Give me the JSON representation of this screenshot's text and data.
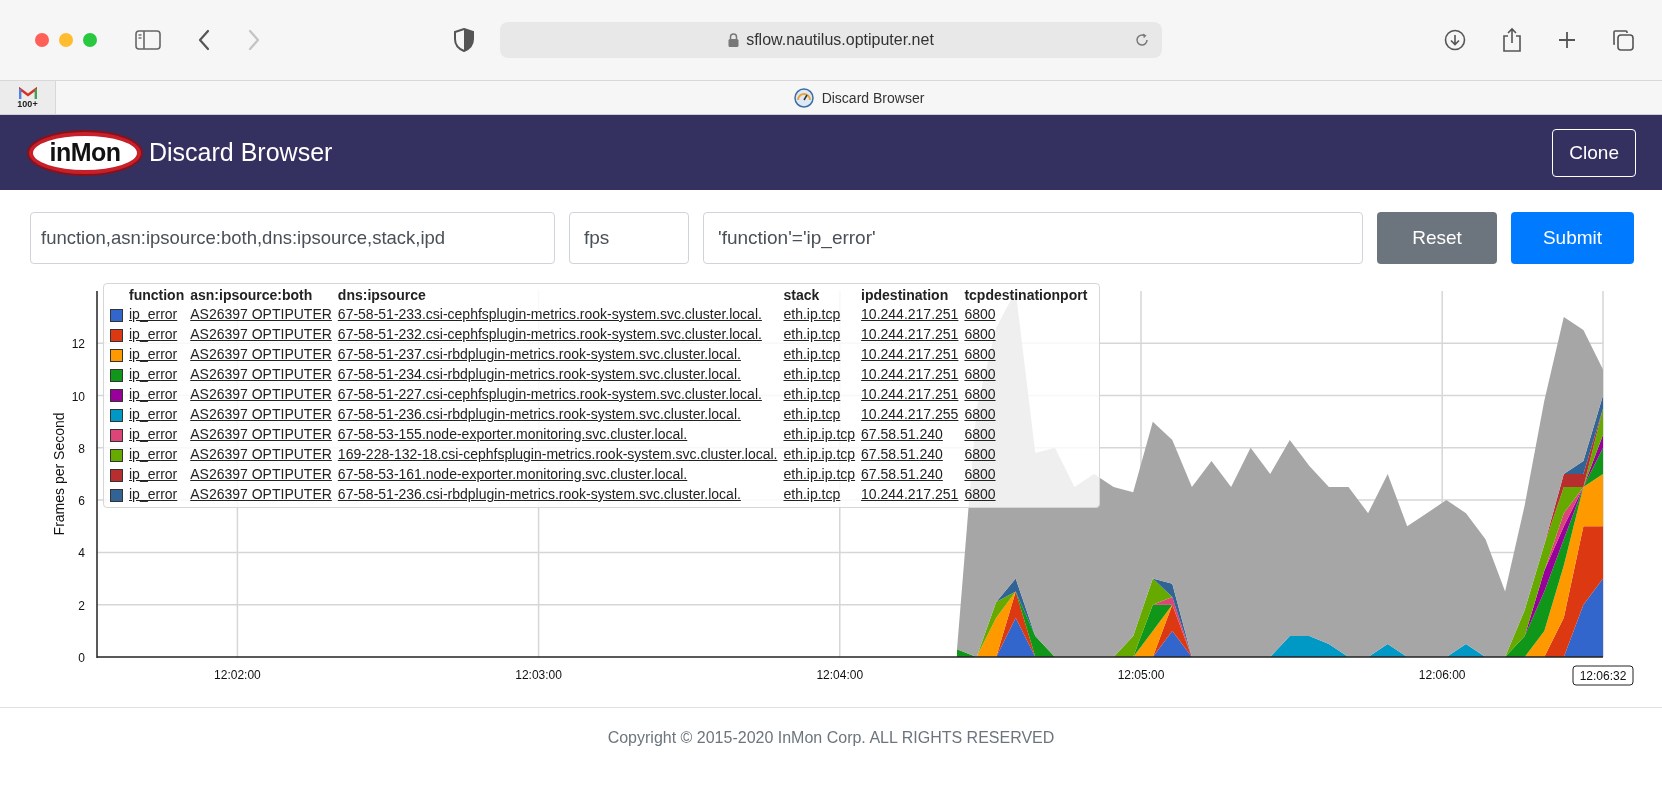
{
  "browser": {
    "url": "sflow.nautilus.optiputer.net",
    "forward_disabled": true,
    "pinned_tab": {
      "badge": "100+"
    },
    "tab": {
      "title": "Discard Browser"
    }
  },
  "navbar": {
    "logo_text": "inMon",
    "title": "Discard Browser",
    "button": "Clone"
  },
  "query": {
    "keys": "function,asn:ipsource:both,dns:ipsource,stack,ipd",
    "value": "fps",
    "filter": "'function'='ip_error'",
    "buttons": [
      {
        "label": "Reset",
        "kind": "secondary"
      },
      {
        "label": "Submit",
        "kind": "primary"
      }
    ]
  },
  "chart": {
    "ylabel": "Frames per Second",
    "yticks": [
      "12",
      "10",
      "8",
      "6",
      "4",
      "2",
      "0"
    ],
    "xticks": [
      "12:02:00",
      "12:03:00",
      "12:04:00",
      "12:05:00",
      "12:06:00"
    ],
    "cursor_label": "12:06:32",
    "legend": {
      "columns": [
        "function",
        "asn:ipsource:both",
        "dns:ipsource",
        "stack",
        "ipdestination",
        "tcpdestinationport"
      ],
      "rows": [
        {
          "color": "#3366cc",
          "cells": [
            "ip_error",
            "AS26397 OPTIPUTER",
            "67-58-51-233.csi-cephfsplugin-metrics.rook-system.svc.cluster.local.",
            "eth.ip.tcp",
            "10.244.217.251",
            "6800"
          ]
        },
        {
          "color": "#dc3912",
          "cells": [
            "ip_error",
            "AS26397 OPTIPUTER",
            "67-58-51-232.csi-cephfsplugin-metrics.rook-system.svc.cluster.local.",
            "eth.ip.tcp",
            "10.244.217.251",
            "6800"
          ]
        },
        {
          "color": "#ff9900",
          "cells": [
            "ip_error",
            "AS26397 OPTIPUTER",
            "67-58-51-237.csi-rbdplugin-metrics.rook-system.svc.cluster.local.",
            "eth.ip.tcp",
            "10.244.217.251",
            "6800"
          ]
        },
        {
          "color": "#109618",
          "cells": [
            "ip_error",
            "AS26397 OPTIPUTER",
            "67-58-51-234.csi-rbdplugin-metrics.rook-system.svc.cluster.local.",
            "eth.ip.tcp",
            "10.244.217.251",
            "6800"
          ]
        },
        {
          "color": "#990099",
          "cells": [
            "ip_error",
            "AS26397 OPTIPUTER",
            "67-58-51-227.csi-cephfsplugin-metrics.rook-system.svc.cluster.local.",
            "eth.ip.tcp",
            "10.244.217.251",
            "6800"
          ]
        },
        {
          "color": "#0099c6",
          "cells": [
            "ip_error",
            "AS26397 OPTIPUTER",
            "67-58-51-236.csi-rbdplugin-metrics.rook-system.svc.cluster.local.",
            "eth.ip.tcp",
            "10.244.217.255",
            "6800"
          ]
        },
        {
          "color": "#dd4477",
          "cells": [
            "ip_error",
            "AS26397 OPTIPUTER",
            "67-58-53-155.node-exporter.monitoring.svc.cluster.local.",
            "eth.ip.ip.tcp",
            "67.58.51.240",
            "6800"
          ]
        },
        {
          "color": "#66aa00",
          "cells": [
            "ip_error",
            "AS26397 OPTIPUTER",
            "169-228-132-18.csi-cephfsplugin-metrics.rook-system.svc.cluster.local.",
            "eth.ip.ip.tcp",
            "67.58.51.240",
            "6800"
          ]
        },
        {
          "color": "#b82e2e",
          "cells": [
            "ip_error",
            "AS26397 OPTIPUTER",
            "67-58-53-161.node-exporter.monitoring.svc.cluster.local.",
            "eth.ip.ip.tcp",
            "67.58.51.240",
            "6800"
          ]
        },
        {
          "color": "#316395",
          "cells": [
            "ip_error",
            "AS26397 OPTIPUTER",
            "67-58-51-236.csi-rbdplugin-metrics.rook-system.svc.cluster.local.",
            "eth.ip.tcp",
            "10.244.217.251",
            "6800"
          ]
        }
      ]
    }
  },
  "footer": {
    "copyright": "Copyright © 2015-2020 InMon Corp. ALL RIGHTS RESERVED"
  }
}
